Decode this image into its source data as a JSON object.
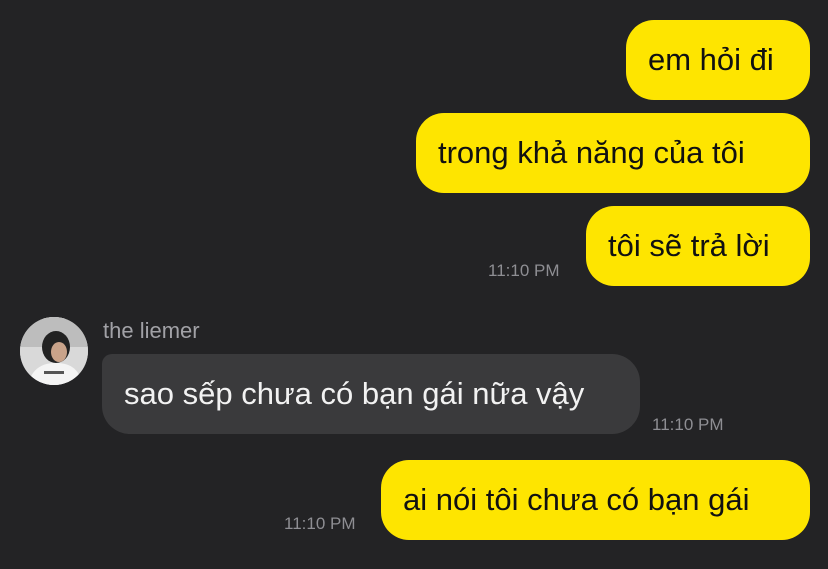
{
  "messages": [
    {
      "text": "em hỏi đi"
    },
    {
      "text": "trong khả năng của tôi"
    },
    {
      "text": "tôi sẽ trả lời",
      "time": "11:10 PM"
    },
    {
      "sender": "the liemer",
      "text": "sao sếp chưa có bạn gái nữa vậy",
      "time": "11:10 PM"
    },
    {
      "text": "ai nói tôi chưa có bạn gái",
      "time": "11:10 PM"
    }
  ],
  "colors": {
    "background": "#232325",
    "outgoing_bubble": "#FEE500",
    "incoming_bubble": "#3A3A3C",
    "timestamp": "#8E8E93"
  }
}
